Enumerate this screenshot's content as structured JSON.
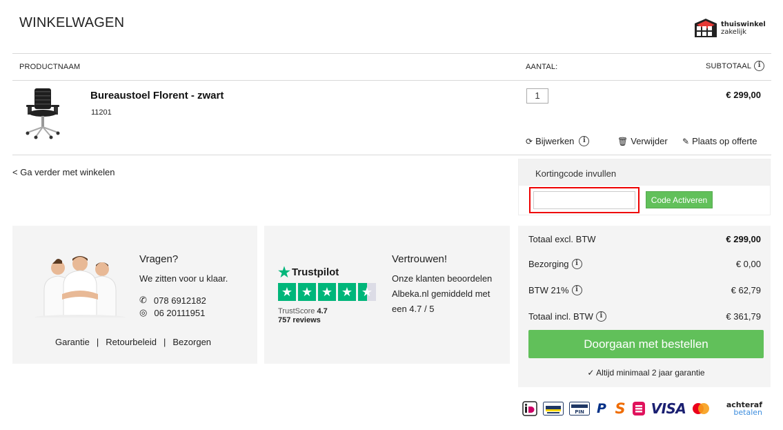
{
  "header": {
    "title": "WINKELWAGEN",
    "logo_line1": "thuiswinkel",
    "logo_line2": "zakelijk"
  },
  "table": {
    "col_product": "PRODUCTNAAM",
    "col_qty": "AANTAL:",
    "col_subtotal": "SUBTOTAAL"
  },
  "item": {
    "name": "Bureaustoel Florent - zwart",
    "sku": "11201",
    "qty": "1",
    "price": "€ 299,00",
    "update_label": "Bijwerken",
    "remove_label": "Verwijder",
    "quote_label": "Plaats op offerte"
  },
  "nav": {
    "continue_label": "< Ga verder met winkelen"
  },
  "coupon": {
    "heading": "Kortingcode invullen",
    "input_value": "",
    "button_label": "Code Activeren"
  },
  "contact": {
    "title": "Vragen?",
    "subtitle": "We zitten voor u klaar.",
    "phone": "078 6912182",
    "whatsapp": "06 20111951",
    "links": [
      "Garantie",
      "Retourbeleid",
      "Bezorgen"
    ],
    "separator": "|"
  },
  "trust": {
    "brand": "Trustpilot",
    "score_label": "TrustScore",
    "score": "4.7",
    "reviews": "757 reviews",
    "stars_rating": 4.5,
    "title": "Vertrouwen!",
    "text": "Onze klanten beoordelen Albeka.nl gemiddeld met een 4.7 / 5"
  },
  "totals": {
    "excl_label": "Totaal excl. BTW",
    "excl_value": "€ 299,00",
    "shipping_label": "Bezorging",
    "shipping_value": "€ 0,00",
    "vat_label": "BTW 21%",
    "vat_value": "€ 62,79",
    "incl_label": "Totaal incl. BTW",
    "incl_value": "€ 361,79",
    "checkout_label": "Doorgaan met bestellen",
    "guarantee_label": "✓ Altijd minimaal 2 jaar garantie"
  },
  "payments": {
    "visa": "VISA",
    "achteraf_line1": "achteraf",
    "achteraf_line2": "betalen",
    "icons": [
      "ideal-icon",
      "bancontact-icon",
      "pin-icon",
      "paypal-icon",
      "sofort-icon",
      "klarna-icon",
      "visa-icon",
      "mastercard-icon",
      "achteraf-betalen-icon"
    ]
  },
  "colors": {
    "accent_green": "#61c05a",
    "trustpilot_green": "#00b67a",
    "highlight_red": "#ee0000"
  }
}
